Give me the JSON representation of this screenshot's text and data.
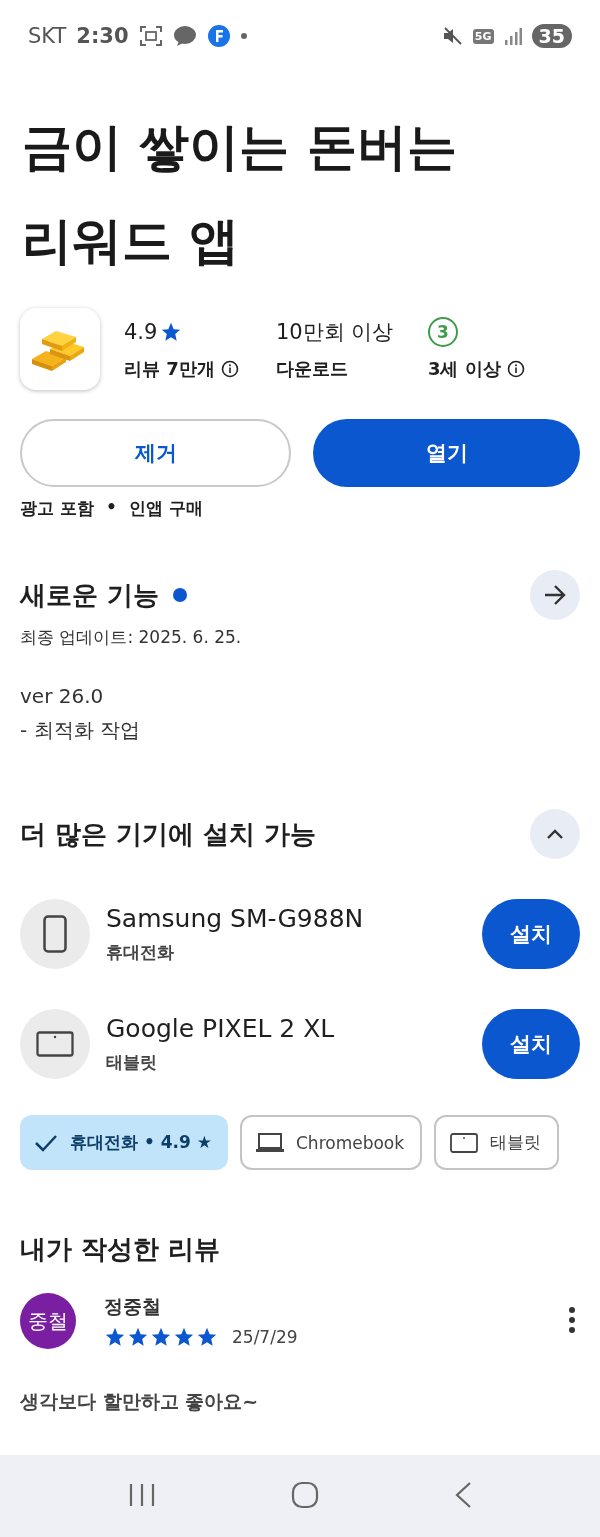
{
  "status_bar": {
    "carrier": "SKT",
    "time": "2:30",
    "network": "5G",
    "battery": "35"
  },
  "title_lines": [
    "금이 쌓이는 돈버는",
    "리워드 앱"
  ],
  "stats": [
    {
      "kind": "rating",
      "value": "4.9",
      "sub": "리뷰 7만개"
    },
    {
      "kind": "downloads",
      "value": "10만회 이상",
      "sub": "다운로드"
    },
    {
      "kind": "age",
      "value": "3",
      "sub": "3세 이상"
    }
  ],
  "buttons": [
    {
      "kind": "outline",
      "label": "제거"
    },
    {
      "kind": "filled",
      "label": "열기"
    }
  ],
  "notes": {
    "separator": "•",
    "items": [
      "광고 포함",
      "인앱 구매"
    ]
  },
  "whats_new": {
    "title": "새로운 기능",
    "new_dot": true,
    "updated": "최종 업데이트: 2025. 6. 25.",
    "lines": [
      "ver 26.0",
      "- 최적화 작업"
    ]
  },
  "more_devices": {
    "title": "더 많은 기기에 설치 가능",
    "expanded": true,
    "devices": [
      {
        "kind": "phone",
        "name": "Samsung SM-G988N",
        "type": "휴대전화",
        "button": "설치"
      },
      {
        "kind": "tablet",
        "name": "Google PIXEL 2 XL",
        "type": "태블릿",
        "button": "설치"
      }
    ]
  },
  "chips": [
    {
      "kind": "phone",
      "label": "휴대전화 • 4.9 ★",
      "selected": true
    },
    {
      "kind": "laptop",
      "label": "Chromebook",
      "selected": false
    },
    {
      "kind": "tablet",
      "label": "태블릿",
      "selected": false
    }
  ],
  "review": {
    "heading": "내가 작성한 리뷰",
    "avatar": "중철",
    "author": "정중철",
    "stars": 5,
    "date": "25/7/29",
    "text": "생각보다 할만하고 좋아요~"
  }
}
